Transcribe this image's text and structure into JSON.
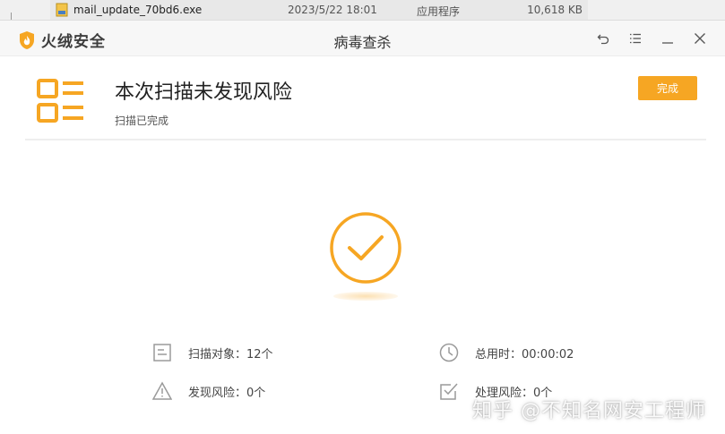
{
  "explorer_row": {
    "filename": "mail_update_70bd6.exe",
    "date": "2023/5/22 18:01",
    "type": "应用程序",
    "size": "10,618 KB"
  },
  "window": {
    "brand": "火绒安全",
    "title": "病毒查杀",
    "controls": [
      "back-icon",
      "menu-icon",
      "minimize-icon",
      "close-icon"
    ]
  },
  "result": {
    "headline": "本次扫描未发现风险",
    "subtitle": "扫描已完成",
    "done_button": "完成"
  },
  "stats": {
    "scan_objects": "扫描对象：12个",
    "total_time": "总用时：00:00:02",
    "risks_found": "发现风险：0个",
    "risks_handled": "处理风险：0个"
  },
  "watermark": "知乎 @不知名网安工程师",
  "colors": {
    "accent": "#f6a623",
    "icon_gray": "#9a9a9a"
  }
}
